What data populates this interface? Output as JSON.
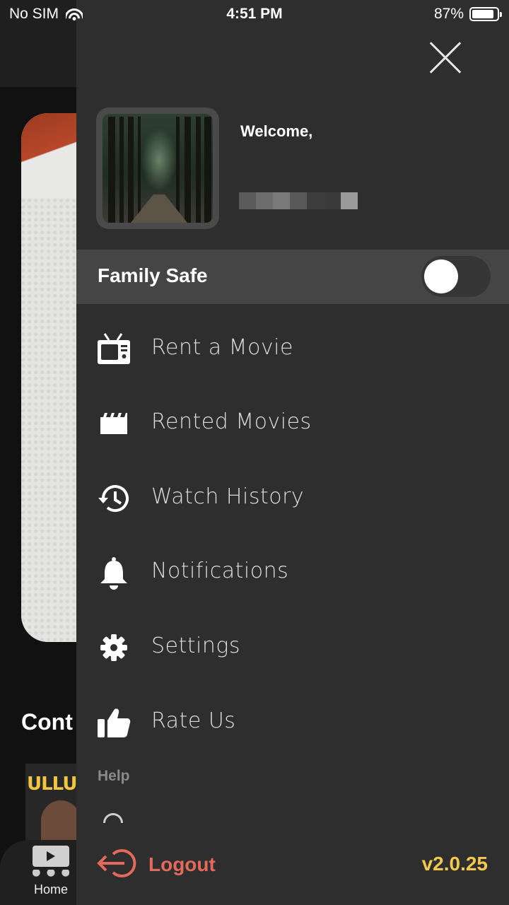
{
  "status_bar": {
    "carrier": "No SIM",
    "time": "4:51 PM",
    "battery_percent": "87%",
    "battery_level": 0.87
  },
  "background": {
    "section_title_partial": "Cont",
    "thumb_logo": "ULLU",
    "tab_home_label": "Home"
  },
  "drawer": {
    "welcome_text": "Welcome,",
    "family_safe": {
      "label": "Family Safe",
      "enabled": false
    },
    "menu_items": [
      {
        "label": "Rent a Movie",
        "icon": "tv-icon"
      },
      {
        "label": "Rented Movies",
        "icon": "clapperboard-icon"
      },
      {
        "label": "Watch History",
        "icon": "history-icon"
      },
      {
        "label": "Notifications",
        "icon": "bell-icon"
      },
      {
        "label": "Settings",
        "icon": "gear-icon"
      },
      {
        "label": "Rate Us",
        "icon": "thumbs-up-icon"
      }
    ],
    "help_section_label": "Help",
    "logout_label": "Logout",
    "version": "v2.0.25"
  },
  "colors": {
    "accent_yellow": "#f2c94c",
    "logout_red": "#e36a5a",
    "drawer_bg": "#2e2e2e",
    "row_bg": "#454545"
  }
}
